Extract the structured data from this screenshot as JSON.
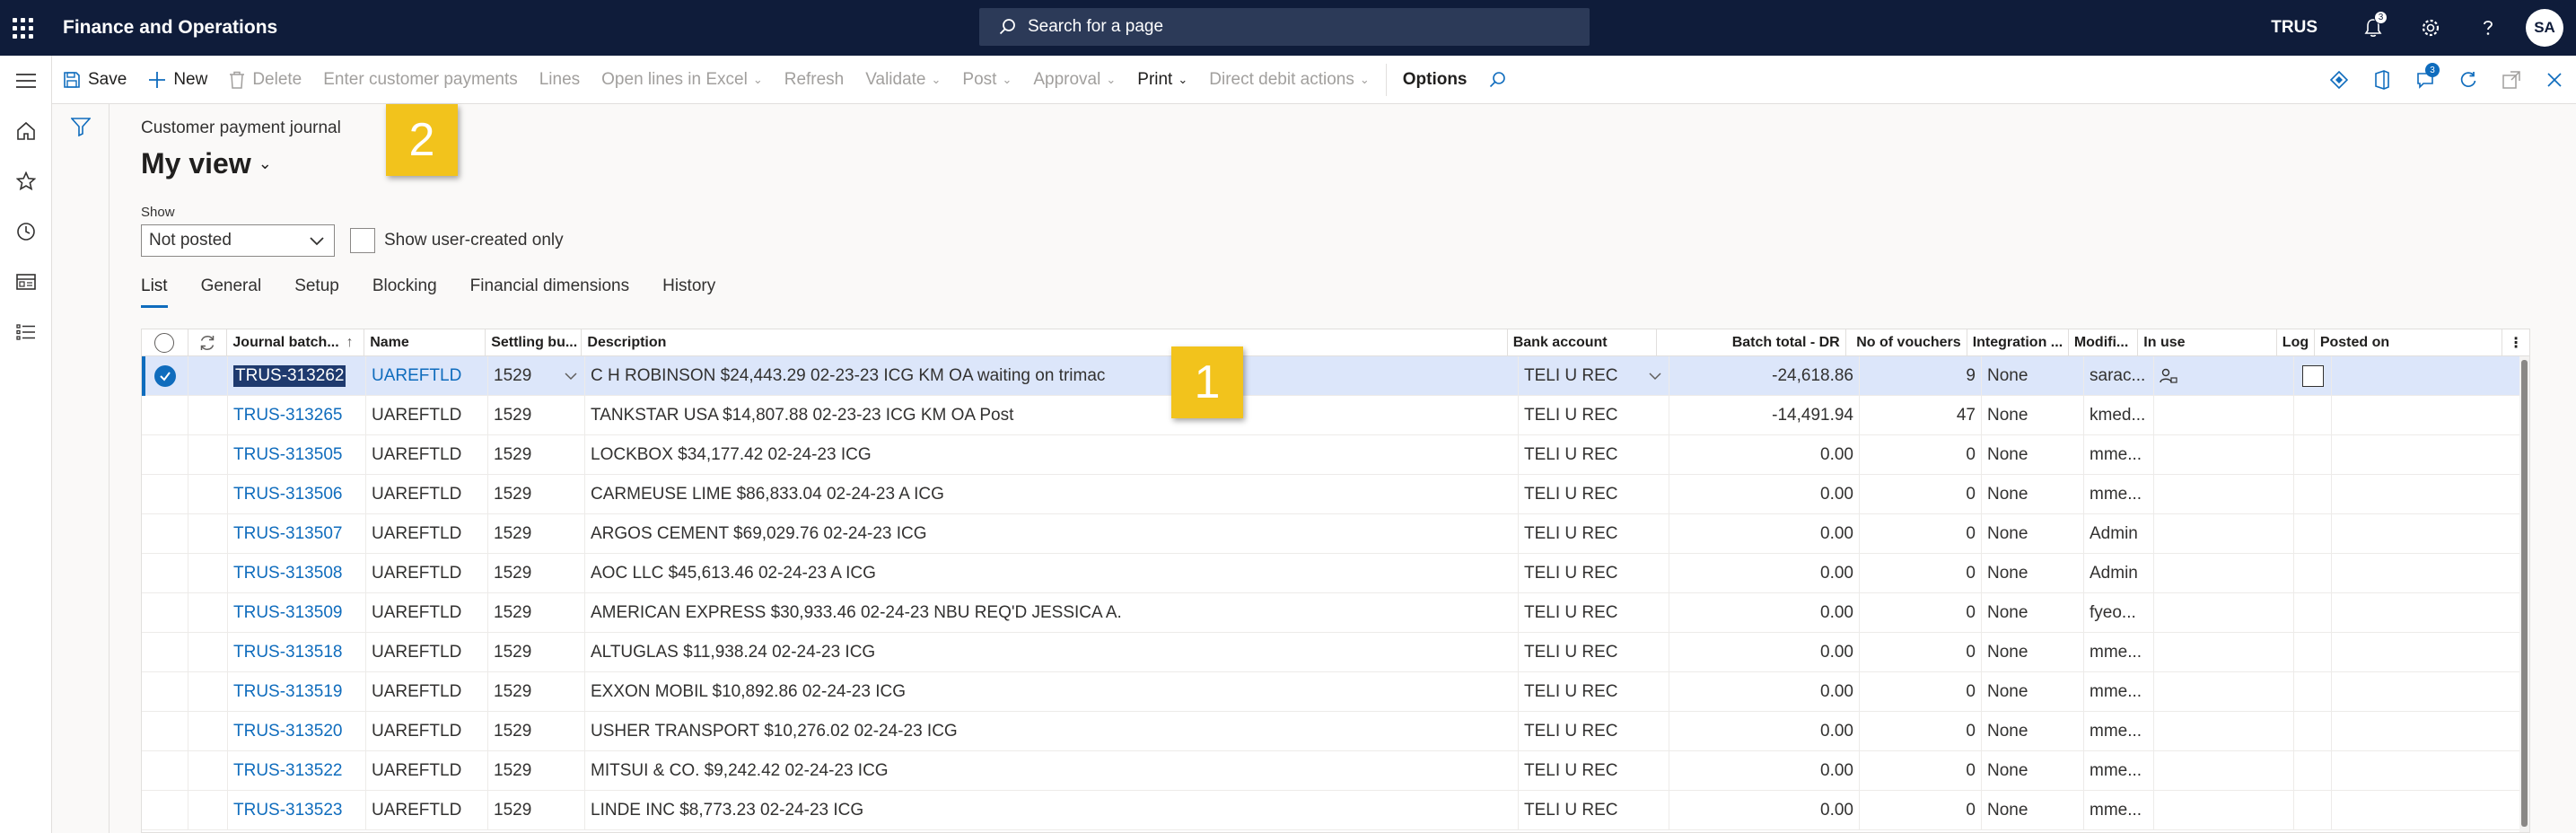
{
  "app": {
    "title": "Finance and Operations",
    "search_placeholder": "Search for a page",
    "company": "TRUS",
    "notification_count": "3",
    "user_initials": "SA"
  },
  "actions": {
    "save": "Save",
    "new": "New",
    "delete": "Delete",
    "enter_payments": "Enter customer payments",
    "lines": "Lines",
    "open_lines_excel": "Open lines in Excel",
    "refresh": "Refresh",
    "validate": "Validate",
    "post": "Post",
    "approval": "Approval",
    "print": "Print",
    "direct_debit": "Direct debit actions",
    "options": "Options",
    "message_count": "3"
  },
  "page": {
    "caption": "Customer payment journal",
    "view_name": "My view",
    "show_label": "Show",
    "show_value": "Not posted",
    "user_created_label": "Show user-created only"
  },
  "tabs": [
    "List",
    "General",
    "Setup",
    "Blocking",
    "Financial dimensions",
    "History"
  ],
  "callouts": [
    "1",
    "2"
  ],
  "grid": {
    "columns": [
      "Journal batch...",
      "Name",
      "Settling bu...",
      "Description",
      "Bank account",
      "Batch total - DR",
      "No of vouchers",
      "Integration ...",
      "Modifi...",
      "In use",
      "Log",
      "Posted on"
    ],
    "rows": [
      {
        "batch": "TRUS-313262",
        "name": "UAREFTLD",
        "settling": "1529",
        "desc": "C H ROBINSON $24,443.29 02-23-23 ICG KM OA waiting on trimac",
        "bank": "TELI U REC",
        "total": "-24,618.86",
        "vouchers": "9",
        "integration": "None",
        "modified": "sarac..."
      },
      {
        "batch": "TRUS-313265",
        "name": "UAREFTLD",
        "settling": "1529",
        "desc": "TANKSTAR USA $14,807.88 02-23-23 ICG KM OA Post",
        "bank": "TELI U REC",
        "total": "-14,491.94",
        "vouchers": "47",
        "integration": "None",
        "modified": "kmed..."
      },
      {
        "batch": "TRUS-313505",
        "name": "UAREFTLD",
        "settling": "1529",
        "desc": "LOCKBOX $34,177.42 02-24-23 ICG",
        "bank": "TELI U REC",
        "total": "0.00",
        "vouchers": "0",
        "integration": "None",
        "modified": "mme..."
      },
      {
        "batch": "TRUS-313506",
        "name": "UAREFTLD",
        "settling": "1529",
        "desc": "CARMEUSE LIME $86,833.04 02-24-23 A ICG",
        "bank": "TELI U REC",
        "total": "0.00",
        "vouchers": "0",
        "integration": "None",
        "modified": "mme..."
      },
      {
        "batch": "TRUS-313507",
        "name": "UAREFTLD",
        "settling": "1529",
        "desc": "ARGOS CEMENT $69,029.76 02-24-23 ICG",
        "bank": "TELI U REC",
        "total": "0.00",
        "vouchers": "0",
        "integration": "None",
        "modified": "Admin"
      },
      {
        "batch": "TRUS-313508",
        "name": "UAREFTLD",
        "settling": "1529",
        "desc": "AOC LLC $45,613.46 02-24-23 A ICG",
        "bank": "TELI U REC",
        "total": "0.00",
        "vouchers": "0",
        "integration": "None",
        "modified": "Admin"
      },
      {
        "batch": "TRUS-313509",
        "name": "UAREFTLD",
        "settling": "1529",
        "desc": "AMERICAN EXPRESS $30,933.46 02-24-23 NBU REQ'D JESSICA A.",
        "bank": "TELI U REC",
        "total": "0.00",
        "vouchers": "0",
        "integration": "None",
        "modified": "fyeo..."
      },
      {
        "batch": "TRUS-313518",
        "name": "UAREFTLD",
        "settling": "1529",
        "desc": "ALTUGLAS $11,938.24 02-24-23 ICG",
        "bank": "TELI U REC",
        "total": "0.00",
        "vouchers": "0",
        "integration": "None",
        "modified": "mme..."
      },
      {
        "batch": "TRUS-313519",
        "name": "UAREFTLD",
        "settling": "1529",
        "desc": "EXXON MOBIL $10,892.86 02-24-23 ICG",
        "bank": "TELI U REC",
        "total": "0.00",
        "vouchers": "0",
        "integration": "None",
        "modified": "mme..."
      },
      {
        "batch": "TRUS-313520",
        "name": "UAREFTLD",
        "settling": "1529",
        "desc": "USHER TRANSPORT $10,276.02 02-24-23 ICG",
        "bank": "TELI U REC",
        "total": "0.00",
        "vouchers": "0",
        "integration": "None",
        "modified": "mme..."
      },
      {
        "batch": "TRUS-313522",
        "name": "UAREFTLD",
        "settling": "1529",
        "desc": "MITSUI & CO. $9,242.42 02-24-23 ICG",
        "bank": "TELI U REC",
        "total": "0.00",
        "vouchers": "0",
        "integration": "None",
        "modified": "mme..."
      },
      {
        "batch": "TRUS-313523",
        "name": "UAREFTLD",
        "settling": "1529",
        "desc": "LINDE INC $8,773.23 02-24-23 ICG",
        "bank": "TELI U REC",
        "total": "0.00",
        "vouchers": "0",
        "integration": "None",
        "modified": "mme..."
      }
    ]
  }
}
